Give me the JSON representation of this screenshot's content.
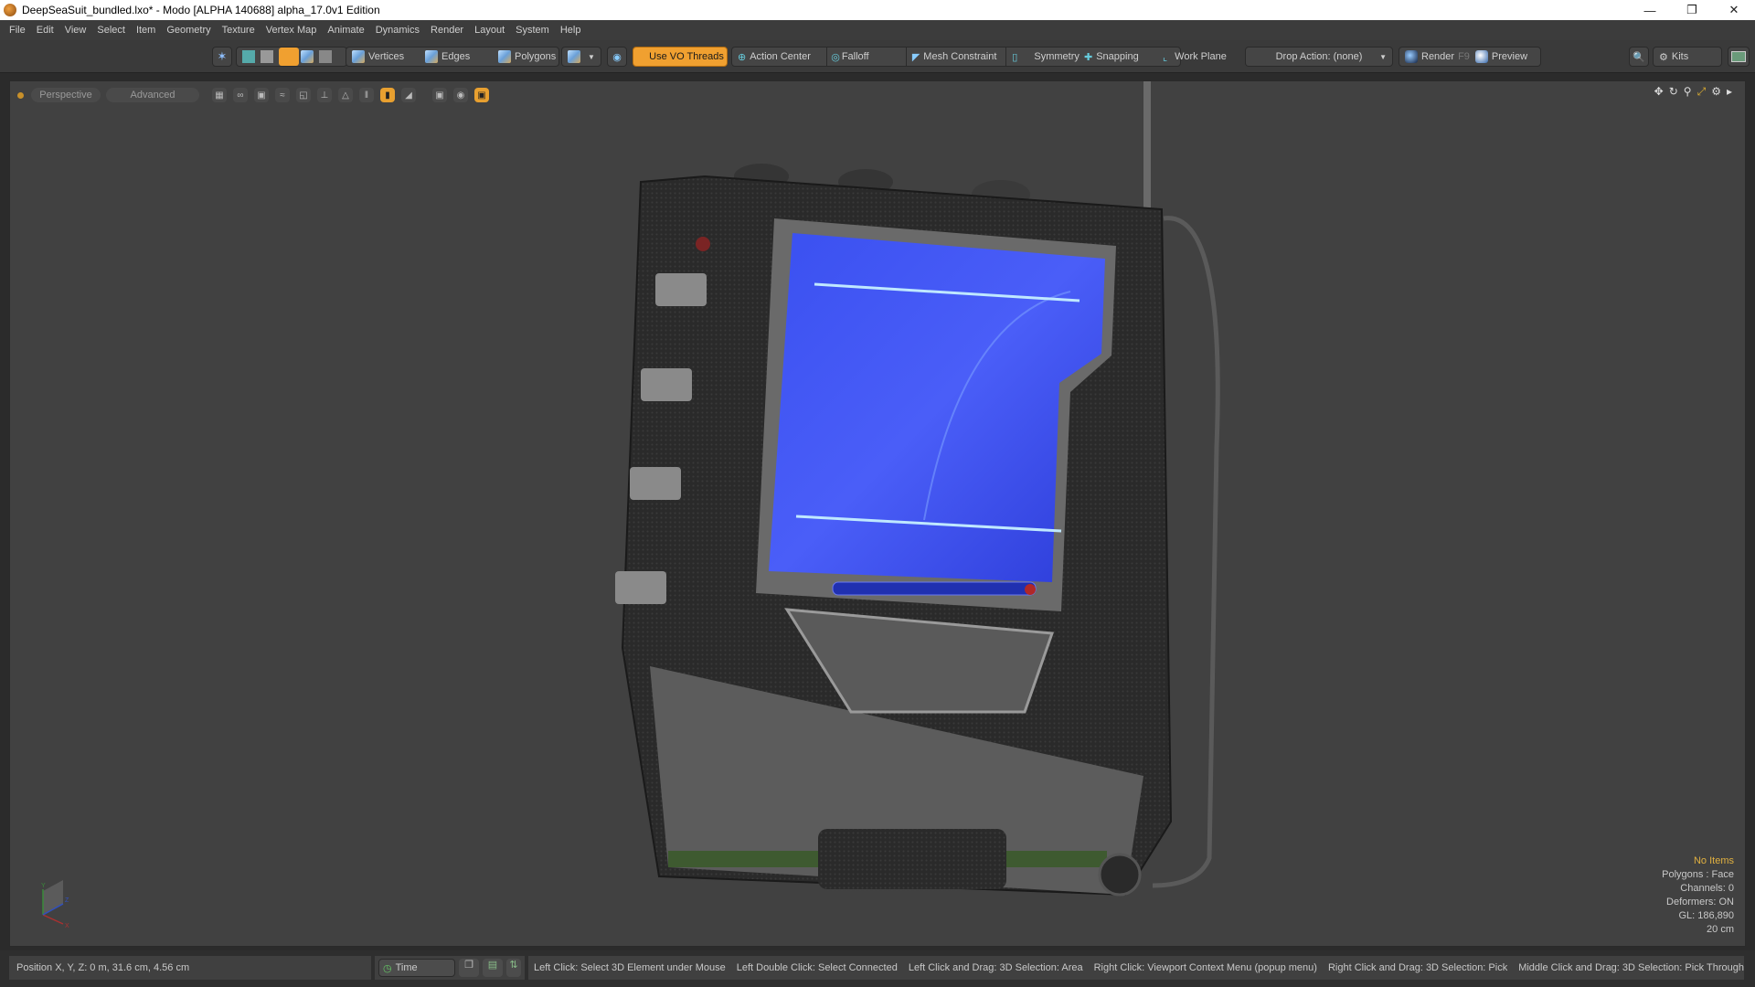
{
  "window": {
    "title": "DeepSeaSuit_bundled.lxo* - Modo [ALPHA 140688]   alpha_17.0v1 Edition",
    "controls": [
      "minimize",
      "restore",
      "close"
    ]
  },
  "menubar": [
    "File",
    "Edit",
    "View",
    "Select",
    "Item",
    "Geometry",
    "Texture",
    "Vertex Map",
    "Animate",
    "Dynamics",
    "Render",
    "Layout",
    "System",
    "Help"
  ],
  "toolbar": {
    "selection_modes": [
      "Vertices",
      "Edges",
      "Polygons"
    ],
    "use_vo_threads": "Use VO Threads",
    "action_center": "Action Center",
    "falloff": "Falloff",
    "mesh_constraint": "Mesh Constraint",
    "symmetry": "Symmetry",
    "snapping": "Snapping",
    "work_plane": "Work Plane",
    "drop_action": "Drop Action: (none)",
    "render": "Render",
    "render_shortcut": "F9",
    "preview": "Preview",
    "kits": "Kits"
  },
  "viewport": {
    "view_mode": "Perspective",
    "shading_mode": "Advanced",
    "info": {
      "selection": "No Items",
      "polygons": "Polygons : Face",
      "channels": "Channels: 0",
      "deformers": "Deformers: ON",
      "gl": "GL: 186,890",
      "grid": "20 cm"
    },
    "axis_labels": [
      "Y",
      "Z",
      "X"
    ]
  },
  "statusbar": {
    "position": "Position X, Y, Z:   0 m, 31.6 cm, 4.56 cm",
    "time_button": "Time",
    "hints": [
      "Left Click: Select 3D Element under Mouse",
      "Left Double Click: Select Connected",
      "Left Click and Drag: 3D Selection: Area",
      "Right Click: Viewport Context Menu (popup menu)",
      "Right Click and Drag: 3D Selection: Pick",
      "Middle Click and Drag: 3D Selection: Pick Through"
    ]
  }
}
